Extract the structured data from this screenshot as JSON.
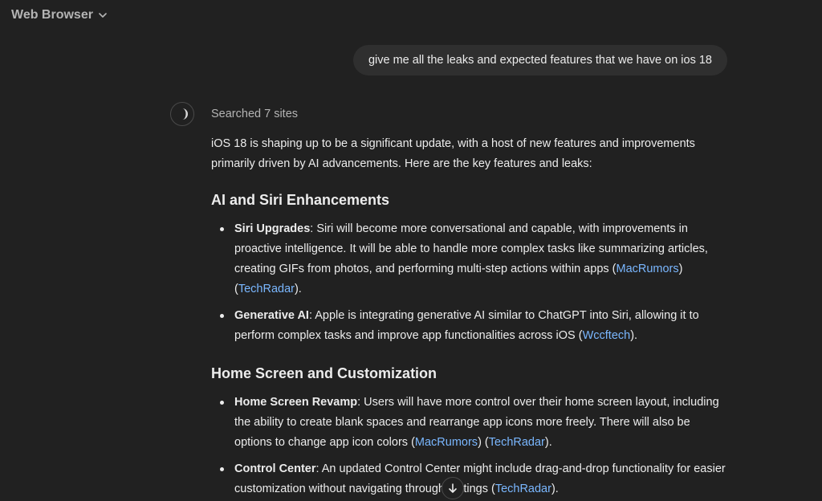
{
  "header": {
    "model_title": "Web Browser",
    "dropdown_icon": "chevron-down-icon"
  },
  "user_message": {
    "text": "give me all the leaks and expected features that we have on ios 18"
  },
  "assistant": {
    "avatar_icon": "loading-spinner-icon",
    "searched_label": "Searched 7 sites",
    "intro": "iOS 18 is shaping up to be a significant update, with a host of new features and improvements primarily driven by AI advancements. Here are the key features and leaks:",
    "sections": [
      {
        "heading": "AI and Siri Enhancements",
        "items": [
          {
            "title": "Siri Upgrades",
            "text": ": Siri will become more conversational and capable, with improvements in proactive intelligence. It will be able to handle more complex tasks like summarizing articles, creating GIFs from photos, and performing multi-step actions within apps (",
            "sources": [
              "MacRumors",
              "TechRadar"
            ]
          },
          {
            "title": "Generative AI",
            "text": ": Apple is integrating generative AI similar to ChatGPT into Siri, allowing it to perform complex tasks and improve app functionalities across iOS (",
            "sources": [
              "Wccftech"
            ]
          }
        ]
      },
      {
        "heading": "Home Screen and Customization",
        "items": [
          {
            "title": "Home Screen Revamp",
            "text": ": Users will have more control over their home screen layout, including the ability to create blank spaces and rearrange app icons more freely. There will also be options to change app icon colors (",
            "sources": [
              "MacRumors",
              "TechRadar"
            ]
          },
          {
            "title": "Control Center",
            "text": ": An updated Control Center might include drag-and-drop functionality for easier customization without navigating through settings (",
            "sources": [
              "TechRadar"
            ]
          }
        ]
      }
    ]
  },
  "scroll_button": {
    "icon": "arrow-down-icon"
  }
}
